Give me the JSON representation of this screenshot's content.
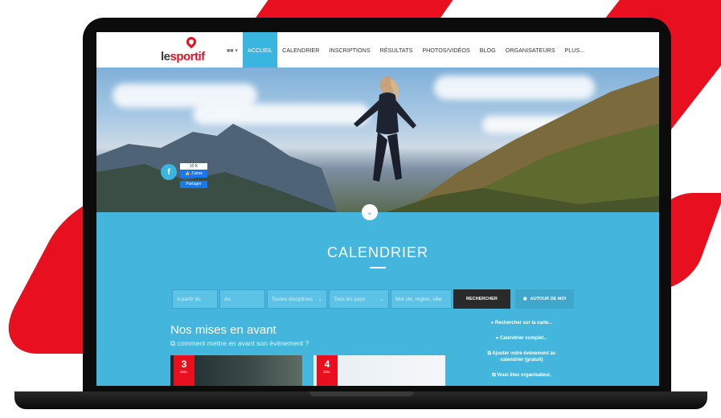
{
  "nav": {
    "logo_text_1": "le",
    "logo_text_2": "sportif",
    "lang_flag": "■■ ▾",
    "items": [
      {
        "label": "ACCUEIL",
        "active": true
      },
      {
        "label": "CALENDRIER",
        "active": false
      },
      {
        "label": "INSCRIPTIONS",
        "active": false
      },
      {
        "label": "RÉSULTATS",
        "active": false
      },
      {
        "label": "PHOTOS/VIDÉOS",
        "active": false
      },
      {
        "label": "BLOG",
        "active": false
      },
      {
        "label": "ORGANISATEURS",
        "active": false
      },
      {
        "label": "PLUS...",
        "active": false
      }
    ]
  },
  "hero": {
    "fb_count": "10 K",
    "fb_like": "👍 J'aime",
    "fb_share": "Partager",
    "fb_icon": "f"
  },
  "calendar": {
    "title": "CALENDRIER",
    "fields": {
      "from": "A partir du",
      "to": "Au",
      "disciplines": "Toutes disciplines",
      "countries": "Tous les pays",
      "keyword": "Mot clé, région, ville"
    },
    "search_button": "RECHERCHER",
    "around_button": "AUTOUR DE MOI"
  },
  "featured": {
    "title": "Nos mises en avant",
    "subtitle": "comment mettre en avant son évènement ?",
    "cards": [
      {
        "day": "3",
        "month": "JUIL."
      },
      {
        "day": "4",
        "month": "JUIL."
      }
    ]
  },
  "side_links": [
    "Rechercher sur la carte...",
    "Calendrier complet...",
    "Ajouter votre évènement au calendrier (gratuit)",
    "Vous êtes organisateur,"
  ],
  "colors": {
    "brand_red": "#e8101e",
    "brand_blue": "#44b6dd",
    "nav_active": "#3ab5e0"
  }
}
